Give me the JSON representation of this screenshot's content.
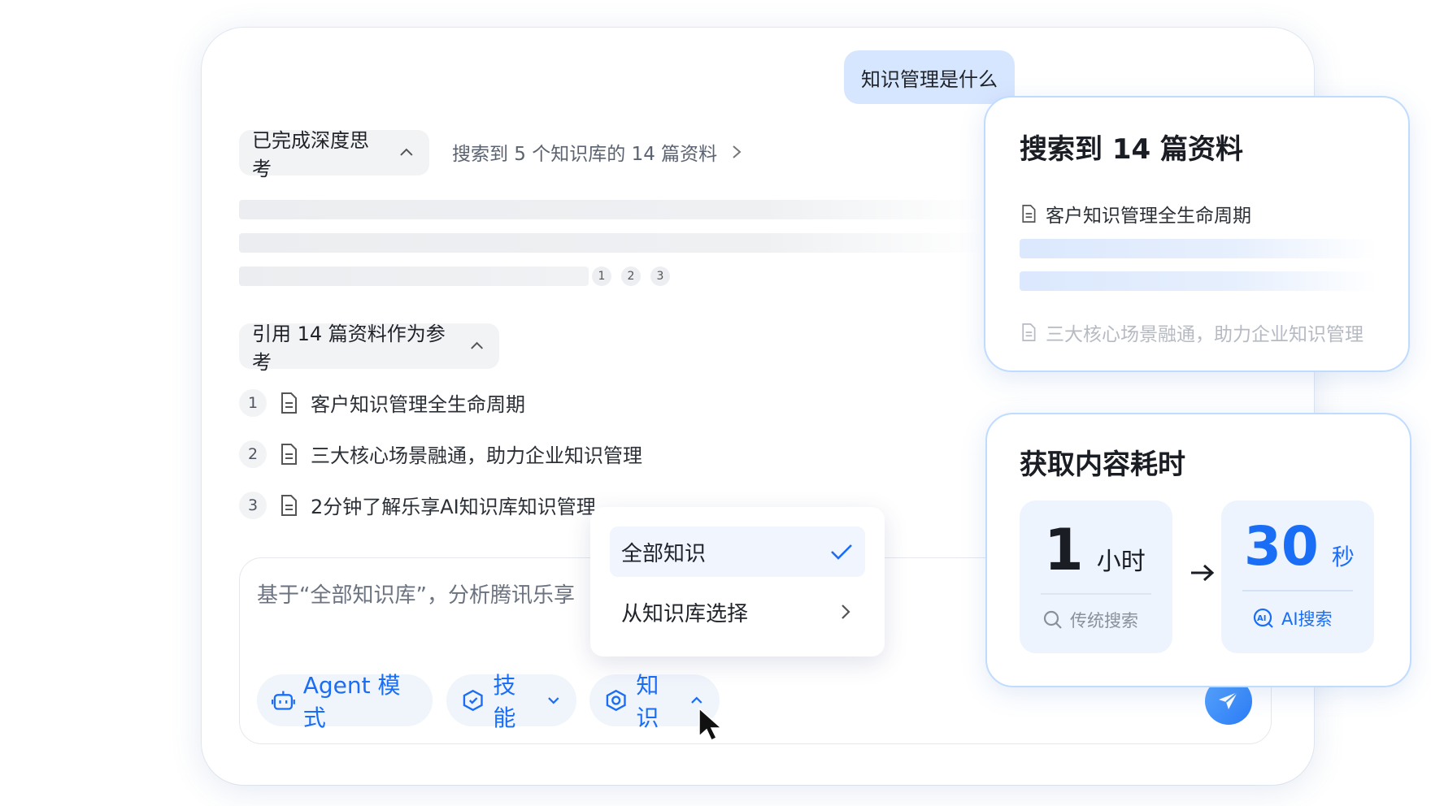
{
  "user_message": "知识管理是什么",
  "thinking": {
    "label": "已完成深度思考",
    "search_summary": "搜索到 5 个知识库的 14 篇资料",
    "citations": [
      "1",
      "2",
      "3"
    ]
  },
  "references": {
    "label": "引用 14 篇资料作为参考",
    "items": [
      {
        "index": "1",
        "title": "客户知识管理全生命周期"
      },
      {
        "index": "2",
        "title": "三大核心场景融通，助力企业知识管理"
      },
      {
        "index": "3",
        "title": "2分钟了解乐享AI知识库知识管理"
      }
    ]
  },
  "input": {
    "placeholder": "基于“全部知识库”，分析腾讯乐享"
  },
  "toolbar": {
    "agent_label": "Agent 模式",
    "skill_label": "技能",
    "knowledge_label": "知识"
  },
  "dropdown": {
    "items": [
      {
        "label": "全部知识",
        "selected": true
      },
      {
        "label": "从知识库选择",
        "selected": false
      }
    ]
  },
  "search_card": {
    "title": "搜索到 14 篇资料",
    "doc_primary": "客户知识管理全生命周期",
    "doc_secondary": "三大核心场景融通，助力企业知识管理"
  },
  "time_card": {
    "title": "获取内容耗时",
    "traditional": {
      "value": "1",
      "unit": "小时",
      "label": "传统搜索"
    },
    "ai": {
      "value": "30",
      "unit": "秒",
      "label": "AI搜索"
    }
  },
  "colors": {
    "accent": "#1a6ef5",
    "user_bubble": "#d7e6ff",
    "card_border": "#bfdcff"
  }
}
